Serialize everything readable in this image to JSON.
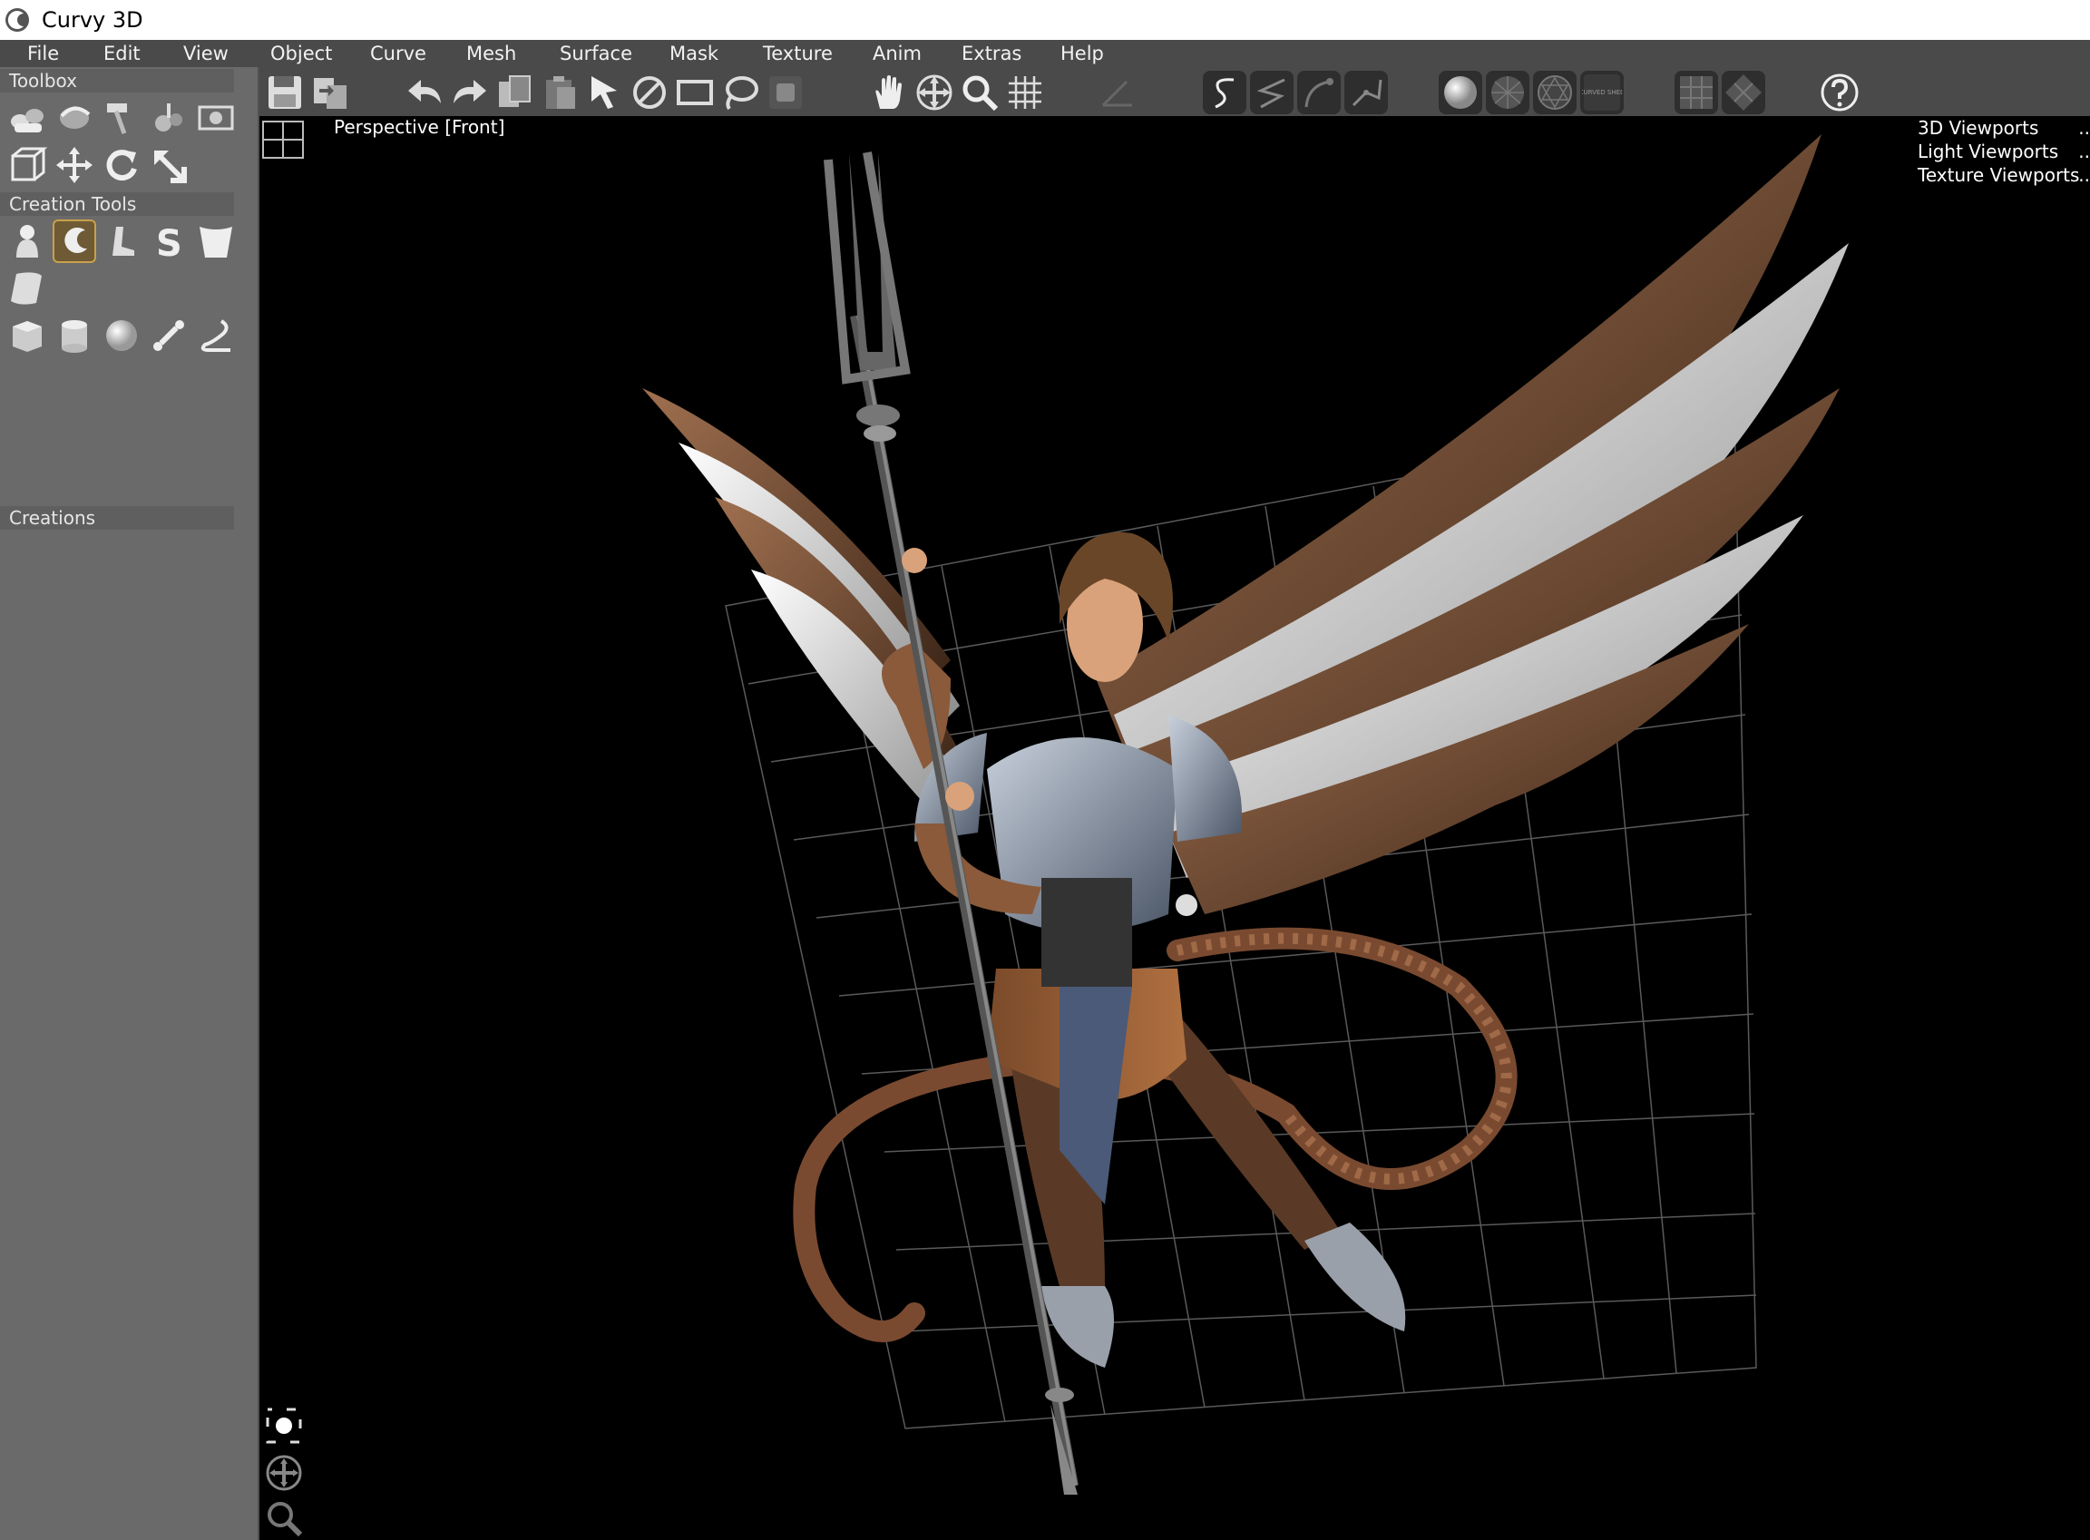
{
  "window": {
    "title": "Curvy 3D"
  },
  "menu": {
    "items": [
      "File",
      "Edit",
      "View",
      "Object",
      "Curve",
      "Mesh",
      "Surface",
      "Mask",
      "Texture",
      "Anim",
      "Extras",
      "Help"
    ]
  },
  "left_panel": {
    "toolbox_label": "Toolbox",
    "creation_tools_label": "Creation Tools",
    "creations_label": "Creations"
  },
  "viewport": {
    "label": "Perspective [Front]",
    "links": [
      "3D Viewports",
      "Light Viewports",
      "Texture Viewports"
    ],
    "link_suffix": ".."
  },
  "toolbar": {
    "layer_badge": "CURVED SHED"
  },
  "colors": {
    "panel_bg": "#6a6a6a",
    "menu_bg": "#4a4a4a",
    "viewport_bg": "#000000",
    "selected_tool": "#c9a14a"
  }
}
